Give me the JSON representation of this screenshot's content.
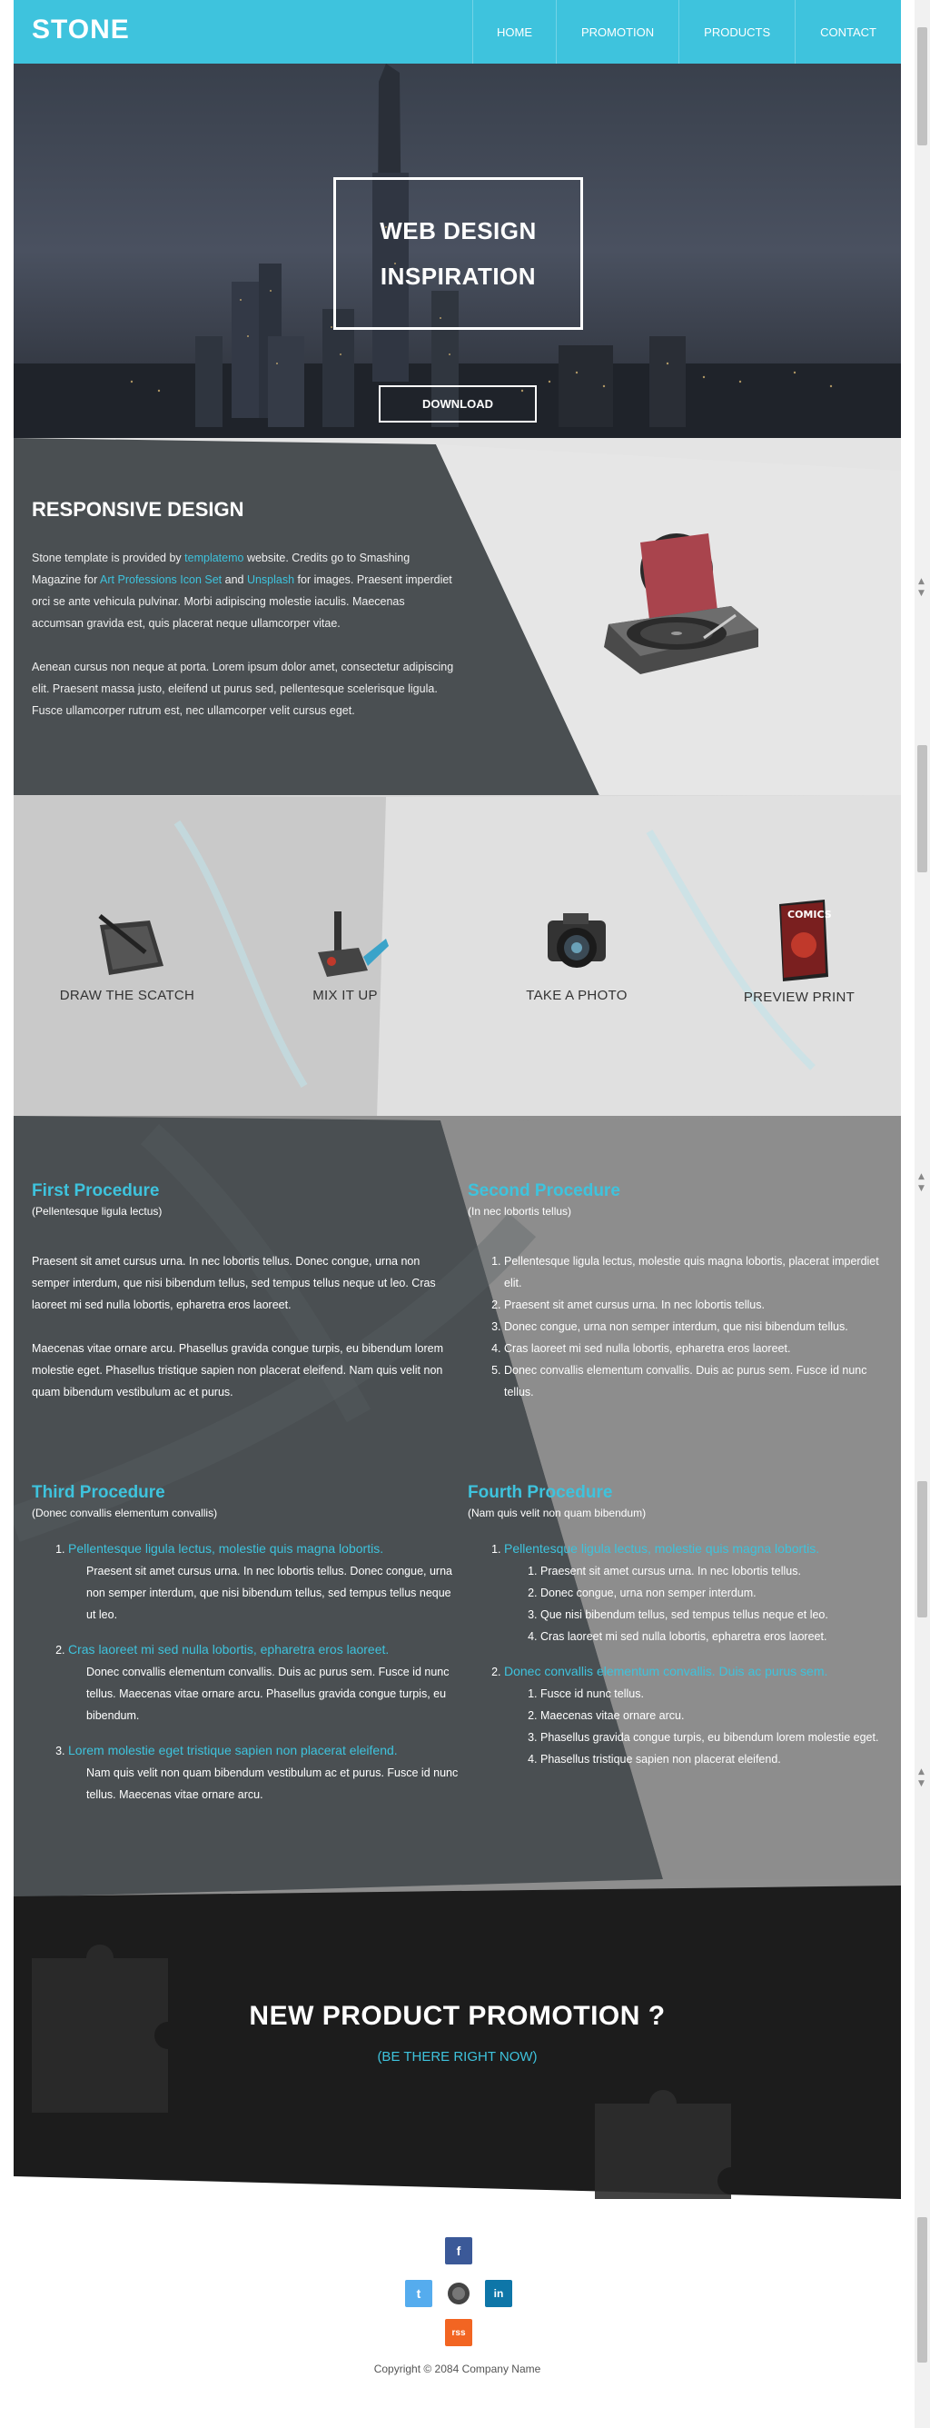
{
  "header": {
    "logo": "STONE",
    "nav": [
      "HOME",
      "PROMOTION",
      "PRODUCTS",
      "CONTACT"
    ]
  },
  "hero": {
    "title_line1": "WEB DESIGN",
    "title_line2": "INSPIRATION",
    "button": "DOWNLOAD"
  },
  "responsive": {
    "title": "RESPONSIVE DESIGN",
    "p1_a": "Stone template is provided by ",
    "p1_link1": "templatemo",
    "p1_b": " website. Credits go to Smashing Magazine for ",
    "p1_link2": "Art Professions Icon Set",
    "p1_c": " and ",
    "p1_link3": "Unsplash",
    "p1_d": " for images. Praesent imperdiet orci se ante vehicula pulvinar. Morbi adipiscing molestie iaculis. Maecenas accumsan gravida est, quis placerat neque ullamcorper vitae.",
    "p2": "Aenean cursus non neque at porta. Lorem ipsum dolor amet, consectetur adipiscing elit. Praesent massa justo, eleifend ut purus sed, pellentesque scelerisque ligula. Fusce ullamcorper rutrum est, nec ullamcorper velit cursus eget."
  },
  "features": [
    "DRAW THE SCATCH",
    "MIX IT UP",
    "TAKE A PHOTO",
    "PREVIEW PRINT"
  ],
  "comics_label": "COMICS",
  "procedures": {
    "first": {
      "title": "First Procedure",
      "sub": "(Pellentesque ligula lectus)",
      "p1": "Praesent sit amet cursus urna. In nec lobortis tellus. Donec congue, urna non semper interdum, que nisi bibendum tellus, sed tempus tellus neque ut leo. Cras laoreet mi sed nulla lobortis, epharetra eros laoreet.",
      "p2": "Maecenas vitae ornare arcu. Phasellus gravida congue turpis, eu bibendum lorem molestie eget. Phasellus tristique sapien non placerat eleifend. Nam quis velit non quam bibendum vestibulum ac et purus."
    },
    "second": {
      "title": "Second Procedure",
      "sub": "(In nec lobortis tellus)",
      "items": [
        "Pellentesque ligula lectus, molestie quis magna lobortis, placerat imperdiet elit.",
        "Praesent sit amet cursus urna. In nec lobortis tellus.",
        "Donec congue, urna non semper interdum, que nisi bibendum tellus.",
        "Cras laoreet mi sed nulla lobortis, epharetra eros laoreet.",
        "Donec convallis elementum convallis. Duis ac purus sem. Fusce id nunc tellus."
      ]
    },
    "third": {
      "title": "Third Procedure",
      "sub": "(Donec convallis elementum convallis)",
      "items": [
        {
          "label": "Pellentesque ligula lectus, molestie quis magna lobortis.",
          "text": "Praesent sit amet cursus urna. In nec lobortis tellus. Donec congue, urna non semper interdum, que nisi bibendum tellus, sed tempus tellus neque ut leo."
        },
        {
          "label": "Cras laoreet mi sed nulla lobortis, epharetra eros laoreet.",
          "text": "Donec convallis elementum convallis. Duis ac purus sem. Fusce id nunc tellus. Maecenas vitae ornare arcu. Phasellus gravida congue turpis, eu bibendum."
        },
        {
          "label": "Lorem molestie eget tristique sapien non placerat eleifend.",
          "text": "Nam quis velit non quam bibendum vestibulum ac et purus. Fusce id nunc tellus. Maecenas vitae ornare arcu."
        }
      ]
    },
    "fourth": {
      "title": "Fourth Procedure",
      "sub": "(Nam quis velit non quam bibendum)",
      "items": [
        {
          "label": "Pellentesque ligula lectus, molestie quis magna lobortis.",
          "sub": [
            "Praesent sit amet cursus urna. In nec lobortis tellus.",
            "Donec congue, urna non semper interdum.",
            "Que nisi bibendum tellus, sed tempus tellus neque et leo.",
            "Cras laoreet mi sed nulla lobortis, epharetra eros laoreet."
          ]
        },
        {
          "label": "Donec convallis elementum convallis. Duis ac purus sem.",
          "sub": [
            "Fusce id nunc tellus.",
            "Maecenas vitae ornare arcu.",
            "Phasellus gravida congue turpis, eu bibendum lorem molestie eget.",
            "Phasellus tristique sapien non placerat eleifend."
          ]
        }
      ]
    }
  },
  "promo": {
    "title": "NEW PRODUCT PROMOTION ?",
    "sub": "(BE THERE RIGHT NOW)"
  },
  "social": {
    "facebook": "f",
    "twitter": "t",
    "linkedin": "in",
    "rss": "rss"
  },
  "footer": {
    "copyright": "Copyright © 2084 Company Name"
  },
  "colors": {
    "accent": "#3ec3dd",
    "dark": "#4a4f52",
    "facebook": "#3b5998",
    "twitter": "#55acee",
    "linkedin": "#0e76a8",
    "rss": "#f26522"
  }
}
